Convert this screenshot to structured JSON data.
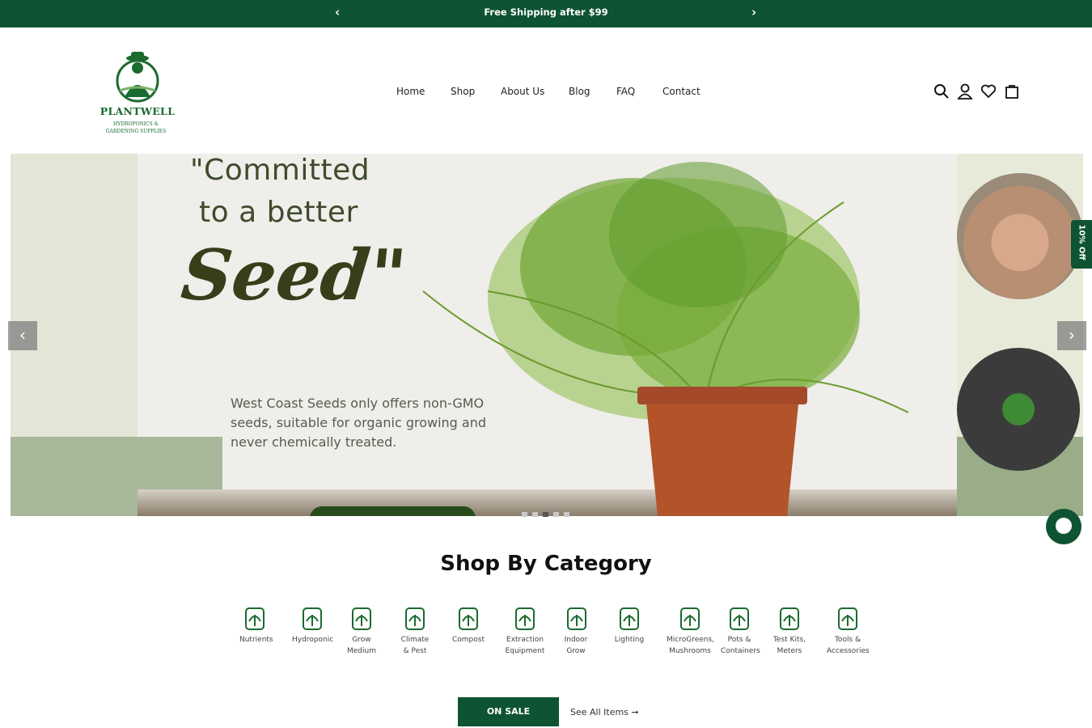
{
  "announcement": {
    "message": "Free Shipping after $99",
    "prev": "‹",
    "next": "›"
  },
  "logo": {
    "brand": "PLANTWELL",
    "tagline_line1": "HYDROPONICS &",
    "tagline_line2": "GARDENING SUPPLIES"
  },
  "nav": [
    "Home",
    "Shop",
    "About Us",
    "Blog",
    "FAQ",
    "Contact"
  ],
  "header_icons": [
    "search-icon",
    "account-icon",
    "wishlist-icon",
    "cart-icon"
  ],
  "hero": {
    "line1": "\"Committed",
    "line2": "to a better",
    "script": "Seed\"",
    "description": "West Coast Seeds only offers non-GMO seeds, suitable for organic growing and never chemically treated.",
    "prev": "‹",
    "next": "›",
    "slides": 5,
    "active_slide": 3
  },
  "side_tab": "10% Off",
  "categories": {
    "title": "Shop By Category",
    "items": [
      {
        "label": "Nutrients",
        "icon": "nutrients-icon"
      },
      {
        "label": "Hydroponic",
        "icon": "hydroponic-icon"
      },
      {
        "label": "Grow\nMedium",
        "icon": "grow-medium-icon"
      },
      {
        "label": "Climate\n& Pest",
        "icon": "climate-pest-icon"
      },
      {
        "label": "Compost",
        "icon": "compost-icon"
      },
      {
        "label": "Extraction\nEquipment",
        "icon": "extraction-icon"
      },
      {
        "label": "Indoor\nGrow",
        "icon": "indoor-grow-icon"
      },
      {
        "label": "Lighting",
        "icon": "lighting-icon"
      },
      {
        "label": "MicroGreens,\nMushrooms",
        "icon": "mushroom-icon"
      },
      {
        "label": "Pots &\nContainers",
        "icon": "pots-icon"
      },
      {
        "label": "Test Kits,\nMeters",
        "icon": "test-kit-icon"
      },
      {
        "label": "Tools &\nAccessories",
        "icon": "tools-icon"
      }
    ]
  },
  "sale_button": "ON SALE",
  "see_all": "See All Items ➞",
  "colors": {
    "brand_green": "#0f5432",
    "text": "#222222"
  }
}
